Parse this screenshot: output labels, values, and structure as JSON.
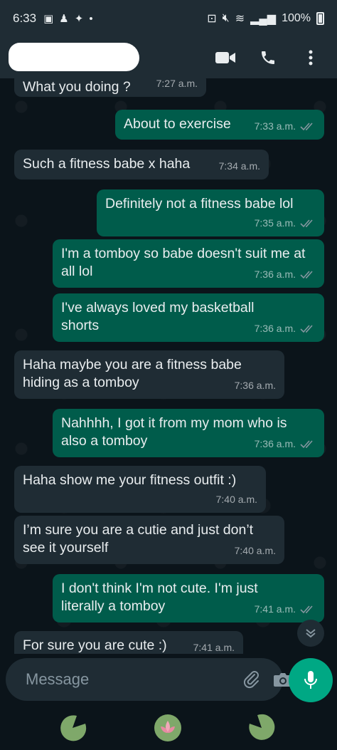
{
  "status_bar": {
    "time": "6:33",
    "battery": "100%"
  },
  "header": {
    "contact_name_redacted": true,
    "actions": [
      "video-call",
      "voice-call",
      "menu"
    ]
  },
  "messages": [
    {
      "dir": "in",
      "text": "What you doing ?",
      "time": "7:27 a.m."
    },
    {
      "dir": "out",
      "text": "About to exercise",
      "time": "7:33 a.m."
    },
    {
      "dir": "in",
      "text": "Such a fitness babe x haha",
      "time": "7:34 a.m."
    },
    {
      "dir": "out",
      "text": "Definitely not a fitness babe lol",
      "time": "7:35 a.m."
    },
    {
      "dir": "out",
      "text": "I'm a tomboy so babe doesn't suit me at all lol",
      "time": "7:36 a.m."
    },
    {
      "dir": "out",
      "text": "I've always loved my basketball shorts",
      "time": "7:36 a.m."
    },
    {
      "dir": "in",
      "text": "Haha maybe you are a fitness babe hiding as a tomboy",
      "time": "7:36 a.m."
    },
    {
      "dir": "out",
      "text": "Nahhhh, I got it from my mom who is also a tomboy",
      "time": "7:36 a.m."
    },
    {
      "dir": "in",
      "text": "Haha show me your fitness outfit :)",
      "time": "7:40 a.m."
    },
    {
      "dir": "in",
      "text": "I’m sure you are a cutie and just don’t see it yourself",
      "time": "7:40 a.m."
    },
    {
      "dir": "out",
      "text": "I don't think I'm not cute. I'm just literally a tomboy",
      "time": "7:41 a.m."
    },
    {
      "dir": "in",
      "text": "For sure you are cute :)",
      "time": "7:41 a.m."
    }
  ],
  "input": {
    "placeholder": "Message"
  },
  "colors": {
    "background": "#0b141a",
    "incoming_bubble": "#1f2c34",
    "outgoing_bubble": "#005c4b",
    "accent": "#00a884",
    "read_ticks": "#8696a0"
  }
}
